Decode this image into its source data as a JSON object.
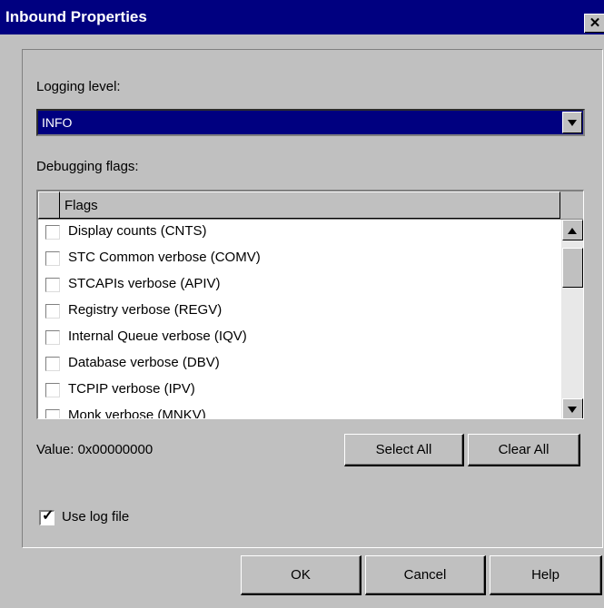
{
  "window": {
    "title": "Inbound Properties",
    "close_glyph": "✕"
  },
  "logging": {
    "label": "Logging level:",
    "selected": "INFO"
  },
  "debug": {
    "label": "Debugging flags:",
    "column_header": "Flags",
    "flags": [
      {
        "label": "Display counts (CNTS)",
        "checked": false
      },
      {
        "label": "STC Common verbose (COMV)",
        "checked": false
      },
      {
        "label": "STCAPIs verbose (APIV)",
        "checked": false
      },
      {
        "label": "Registry verbose (REGV)",
        "checked": false
      },
      {
        "label": "Internal Queue verbose (IQV)",
        "checked": false
      },
      {
        "label": "Database verbose (DBV)",
        "checked": false
      },
      {
        "label": "TCPIP verbose (IPV)",
        "checked": false
      },
      {
        "label": "Monk verbose (MNKV)",
        "checked": false
      }
    ]
  },
  "value_text": "Value: 0x00000000",
  "buttons": {
    "select_all": "Select All",
    "clear_all": "Clear All",
    "ok": "OK",
    "cancel": "Cancel",
    "help": "Help"
  },
  "use_log_file": {
    "label": "Use log file",
    "checked": true,
    "check_glyph": "✓"
  }
}
